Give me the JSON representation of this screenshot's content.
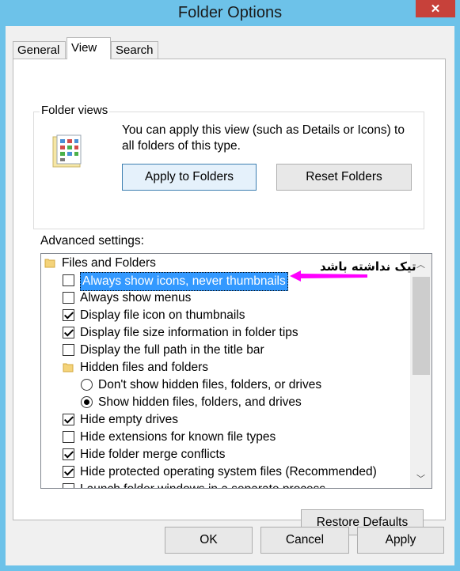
{
  "window": {
    "title": "Folder Options",
    "close_glyph": "✕",
    "accent": "#6dc2e9",
    "close_color": "#c7413a"
  },
  "tabs": [
    {
      "label": "General",
      "active": false
    },
    {
      "label": "View",
      "active": true
    },
    {
      "label": "Search",
      "active": false
    }
  ],
  "folder_views": {
    "legend": "Folder views",
    "description": "You can apply this view (such as Details or Icons) to all folders of this type.",
    "apply_label": "Apply to Folders",
    "reset_label": "Reset Folders"
  },
  "advanced": {
    "label": "Advanced settings:",
    "annotation": "تیک نداشته باشد",
    "annotation_color": "#ff00ff",
    "items": [
      {
        "type": "folder",
        "label": "Files and Folders",
        "indent": 0
      },
      {
        "type": "checkbox",
        "label": "Always show icons, never thumbnails",
        "checked": false,
        "selected": true,
        "indent": 1
      },
      {
        "type": "checkbox",
        "label": "Always show menus",
        "checked": false,
        "indent": 1
      },
      {
        "type": "checkbox",
        "label": "Display file icon on thumbnails",
        "checked": true,
        "indent": 1
      },
      {
        "type": "checkbox",
        "label": "Display file size information in folder tips",
        "checked": true,
        "indent": 1
      },
      {
        "type": "checkbox",
        "label": "Display the full path in the title bar",
        "checked": false,
        "indent": 1
      },
      {
        "type": "folder",
        "label": "Hidden files and folders",
        "indent": 1
      },
      {
        "type": "radio",
        "label": "Don't show hidden files, folders, or drives",
        "checked": false,
        "indent": 2
      },
      {
        "type": "radio",
        "label": "Show hidden files, folders, and drives",
        "checked": true,
        "indent": 2
      },
      {
        "type": "checkbox",
        "label": "Hide empty drives",
        "checked": true,
        "indent": 1
      },
      {
        "type": "checkbox",
        "label": "Hide extensions for known file types",
        "checked": false,
        "indent": 1
      },
      {
        "type": "checkbox",
        "label": "Hide folder merge conflicts",
        "checked": true,
        "indent": 1
      },
      {
        "type": "checkbox",
        "label": "Hide protected operating system files (Recommended)",
        "checked": true,
        "indent": 1
      },
      {
        "type": "checkbox",
        "label": "Launch folder windows in a separate process",
        "checked": false,
        "indent": 1
      }
    ]
  },
  "restore_label": "Restore Defaults",
  "footer": {
    "ok_label": "OK",
    "cancel_label": "Cancel",
    "apply_label": "Apply"
  }
}
